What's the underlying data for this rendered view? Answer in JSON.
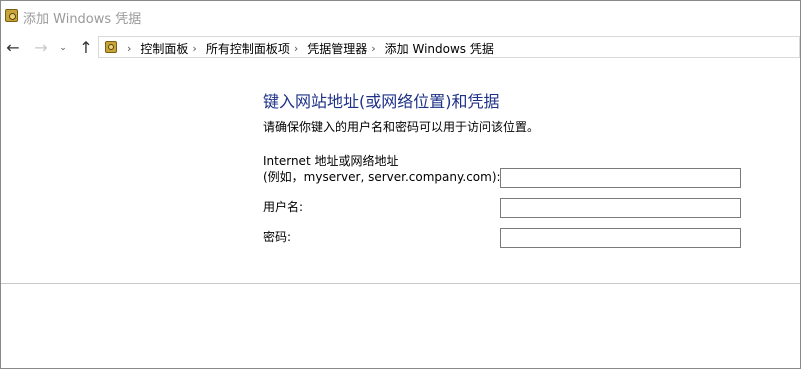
{
  "window": {
    "title": "添加 Windows 凭据"
  },
  "nav": {
    "back_icon": "arrow-left-icon",
    "forward_icon": "arrow-right-icon",
    "recent_icon": "chevron-down-icon",
    "up_icon": "arrow-up-icon"
  },
  "breadcrumb": {
    "items": [
      {
        "label": "控制面板"
      },
      {
        "label": "所有控制面板项"
      },
      {
        "label": "凭据管理器"
      },
      {
        "label": "添加 Windows 凭据"
      }
    ]
  },
  "main": {
    "heading": "键入网站地址(或网络位置)和凭据",
    "instruction": "请确保你键入的用户名和密码可以用于访问该位置。",
    "fields": [
      {
        "label_line1": "Internet 地址或网络地址",
        "label_line2": "(例如，myserver, server.company.com):",
        "value": ""
      },
      {
        "label": "用户名:",
        "value": ""
      },
      {
        "label": "密码:",
        "value": ""
      }
    ]
  }
}
